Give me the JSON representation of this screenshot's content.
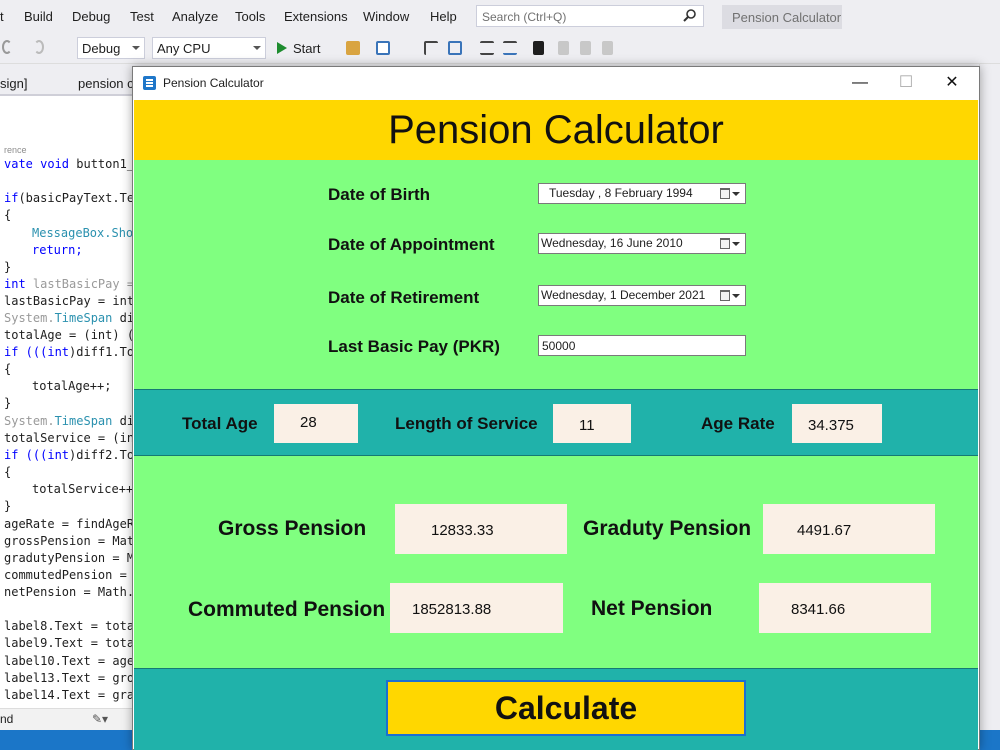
{
  "ide": {
    "menu": [
      "t",
      "Build",
      "Debug",
      "Test",
      "Analyze",
      "Tools",
      "Extensions",
      "Window",
      "Help"
    ],
    "search_placeholder": "Search (Ctrl+Q)",
    "solution_title": "Pension Calculator",
    "toolbar": {
      "config": "Debug",
      "platform": "Any CPU",
      "start": "Start"
    },
    "doc_tabs": [
      "sign]",
      "pension c"
    ],
    "status_left": "nd",
    "code": {
      "ref": "rence",
      "sig_mod": "vate void",
      "sig_rest": " button1_C",
      "l1_kw": "if",
      "l1_rest": "(basicPayText.Te",
      "brace_open": "{",
      "brace_close": "}",
      "msgbox": "MessageBox.Sho",
      "ret": "return;",
      "int_kw": "int",
      "int_rest": " lastBasicPay =",
      "lastbasic": "lastBasicPay = int",
      "sys": "System.",
      "timespan": "TimeSpan",
      "di": " di",
      "totalage": "totalAge = (int) (",
      "if_int": "if (((",
      "diff1": ")diff1.To",
      "totalage_inc": "totalAge++;",
      "totalservice": "totalService = (in",
      "diff2": ")diff2.To",
      "totalservice_inc": "totalService++",
      "agerate": "ageRate = findAgeR",
      "gross": "grossPension = Mat",
      "graduty": "gradutyPension = M",
      "commuted": "commutedPension =",
      "net": "netPension = Math.",
      "label8": "label8.Text = tota",
      "label9": "label9.Text = tota",
      "label10": "label10.Text = age",
      "label13": "label13.Text = gro",
      "label14": "label14.Text = gra"
    }
  },
  "window": {
    "title": "Pension Calculator",
    "controls": {
      "minimize": "—",
      "maximize": "☐",
      "close": "✕"
    }
  },
  "app": {
    "heading": "Pension Calculator",
    "inputs": {
      "dob": {
        "label": "Date of Birth",
        "value": "Tuesday  ,  8  February  1994"
      },
      "doa": {
        "label": "Date of Appointment",
        "value": "Wednesday, 16     June     2010"
      },
      "dor": {
        "label": "Date of Retirement",
        "value": "Wednesday,  1 December 2021"
      },
      "pay": {
        "label": "Last Basic Pay (PKR)",
        "value": "50000"
      }
    },
    "summary": {
      "total_age": {
        "label": "Total Age",
        "value": "28"
      },
      "service": {
        "label": "Length of Service",
        "value": "11"
      },
      "age_rate": {
        "label": "Age Rate",
        "value": "34.375"
      }
    },
    "results": {
      "gross": {
        "label": "Gross Pension",
        "value": "12833.33"
      },
      "graduty": {
        "label": "Graduty Pension",
        "value": "4491.67"
      },
      "commuted": {
        "label": "Commuted Pension",
        "value": "1852813.88"
      },
      "net": {
        "label": "Net Pension",
        "value": "8341.66"
      }
    },
    "calculate_label": "Calculate"
  },
  "colors": {
    "header": "#ffd700",
    "panel_green": "#80ff80",
    "panel_teal": "#20b2aa",
    "output_box": "#faf0e6",
    "ide_accent": "#1b76c8"
  }
}
